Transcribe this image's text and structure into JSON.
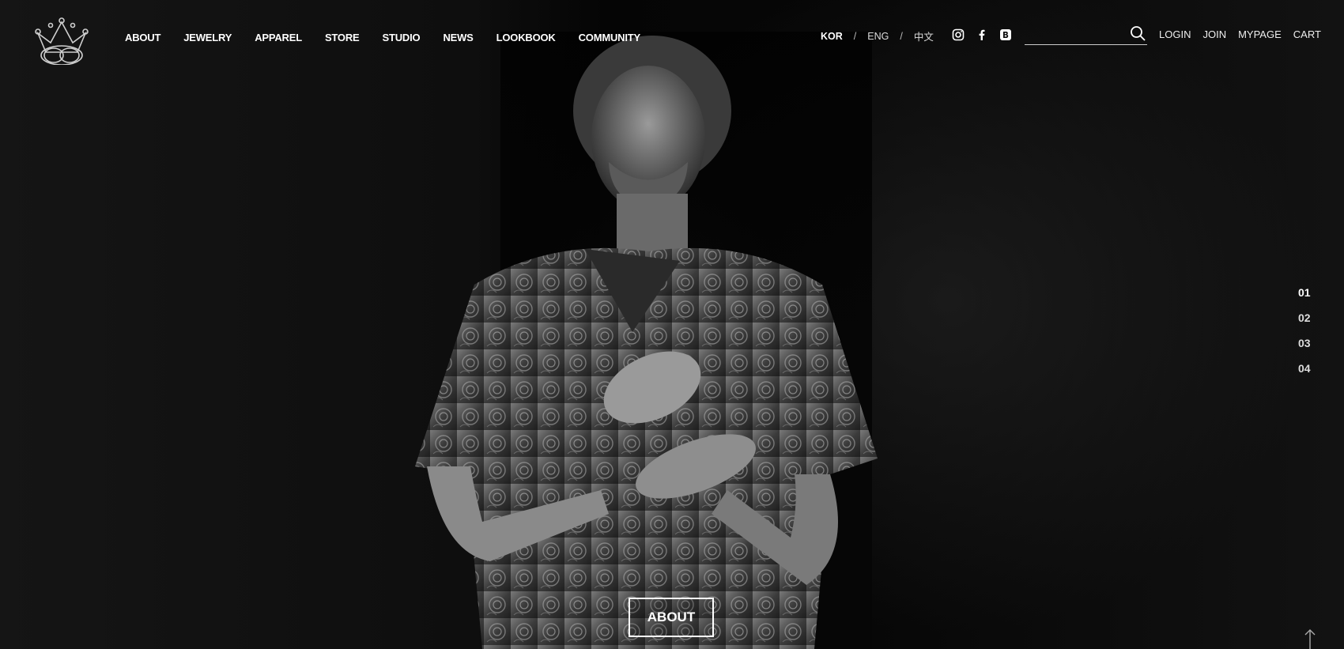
{
  "nav": {
    "items": [
      "ABOUT",
      "JEWELRY",
      "APPAREL",
      "STORE",
      "STUDIO",
      "NEWS",
      "LOOKBOOK",
      "COMMUNITY"
    ]
  },
  "lang": {
    "kor": "KOR",
    "sep1": "/",
    "eng": "ENG",
    "sep2": "/",
    "zh": "中文",
    "active": "KOR"
  },
  "social": [
    "instagram-icon",
    "facebook-icon",
    "blog-icon"
  ],
  "search": {
    "placeholder": "",
    "value": ""
  },
  "util": {
    "login": "LOGIN",
    "join": "JOIN",
    "mypage": "MYPAGE",
    "cart": "CART"
  },
  "pager": {
    "items": [
      "01",
      "02",
      "03",
      "04"
    ],
    "active": "01"
  },
  "hero": {
    "button_label": "ABOUT"
  },
  "colors": {
    "background": "#0c0c0c",
    "text": "#ffffff"
  }
}
